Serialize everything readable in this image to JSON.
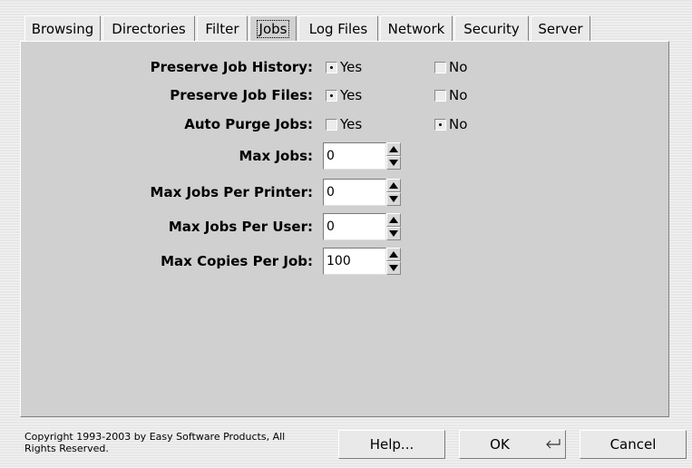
{
  "tabs": [
    {
      "label": "Browsing"
    },
    {
      "label": "Directories"
    },
    {
      "label": "Filter"
    },
    {
      "label": "Jobs",
      "active": true
    },
    {
      "label": "Log Files"
    },
    {
      "label": "Network"
    },
    {
      "label": "Security"
    },
    {
      "label": "Server"
    }
  ],
  "jobs": {
    "preserve_history": {
      "label": "Preserve Job History:",
      "yes": "Yes",
      "no": "No",
      "selected": "Yes"
    },
    "preserve_files": {
      "label": "Preserve Job Files:",
      "yes": "Yes",
      "no": "No",
      "selected": "Yes"
    },
    "auto_purge": {
      "label": "Auto Purge Jobs:",
      "yes": "Yes",
      "no": "No",
      "selected": "No"
    },
    "max_jobs": {
      "label": "Max Jobs:",
      "value": "0"
    },
    "max_jobs_per_printer": {
      "label": "Max Jobs Per Printer:",
      "value": "0"
    },
    "max_jobs_per_user": {
      "label": "Max Jobs Per User:",
      "value": "0"
    },
    "max_copies_per_job": {
      "label": "Max Copies Per Job:",
      "value": "100"
    }
  },
  "footer": {
    "copyright": "Copyright 1993-2003 by Easy Software Products, All Rights Reserved.",
    "help_label": "Help...",
    "ok_label": "OK",
    "ok_icon": "return-key-icon",
    "cancel_label": "Cancel"
  }
}
